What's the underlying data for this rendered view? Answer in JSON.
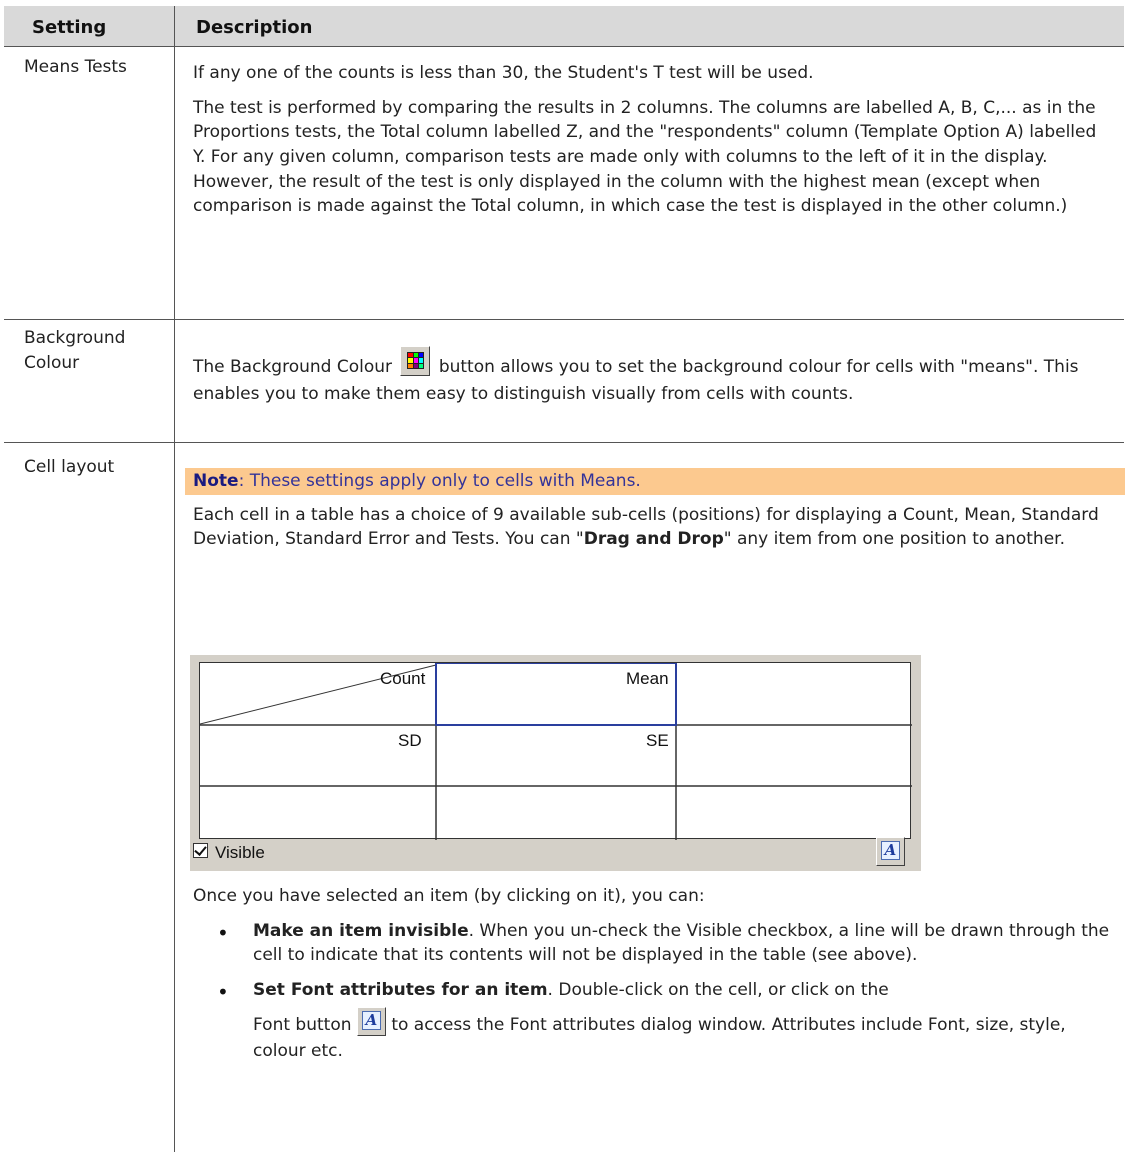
{
  "header": {
    "col1": "Setting",
    "col2": "Description"
  },
  "rows": [
    {
      "setting": "Means Tests",
      "paragraphs": [
        "If any one of the counts is less than 30, the Student's T test will be used.",
        "The test is performed by comparing the results in 2 columns. The columns are labelled A, B, C,... as in the Proportions tests, the Total column labelled Z, and the \"respondents\" column (Template Option A) labelled Y. For any given column, comparison tests are made only with columns to the left of it in the display. However, the result of the test is only displayed in the column with the highest mean (except when comparison is made against the Total column, in which case the test is displayed in the other column.)"
      ]
    },
    {
      "setting": "Background Colour",
      "text_before": "The Background Colour",
      "text_after": "button allows you to set the background colour for cells with \"means\". This enables you to make them easy to distinguish visually from cells with counts."
    },
    {
      "setting": "Cell layout",
      "note_label": "Note",
      "note_text": ": These settings apply only to cells with Means.",
      "intro_a": "Each cell in a table has a choice of 9 available sub-cells (positions) for displaying a Count, Mean, Standard Deviation, Standard Error and Tests. You can \"",
      "intro_bold": "Drag and Drop",
      "intro_b": "\" any item from one position to another.",
      "after_panel": "Once you have selected an item (by clicking on it), you can:",
      "bullets": [
        {
          "bold": "Make an item invisible",
          "text": ". When you un-check the Visible checkbox, a line will be drawn through the cell to indicate that its contents will not be displayed in the table (see above)."
        },
        {
          "bold": "Set Font attributes for an item",
          "text_a": ". Double-click on the cell, or click on the",
          "text_b": "Font button",
          "text_c": "to access the Font attributes dialog window. Attributes include Font, size, style, colour etc."
        }
      ]
    }
  ],
  "cell_editor": {
    "cells": [
      "Count",
      "Mean",
      "SD",
      "SE"
    ],
    "checkbox_label": "Visible",
    "checkbox_checked": true
  },
  "icons": [
    "palette-icon",
    "font-icon"
  ]
}
